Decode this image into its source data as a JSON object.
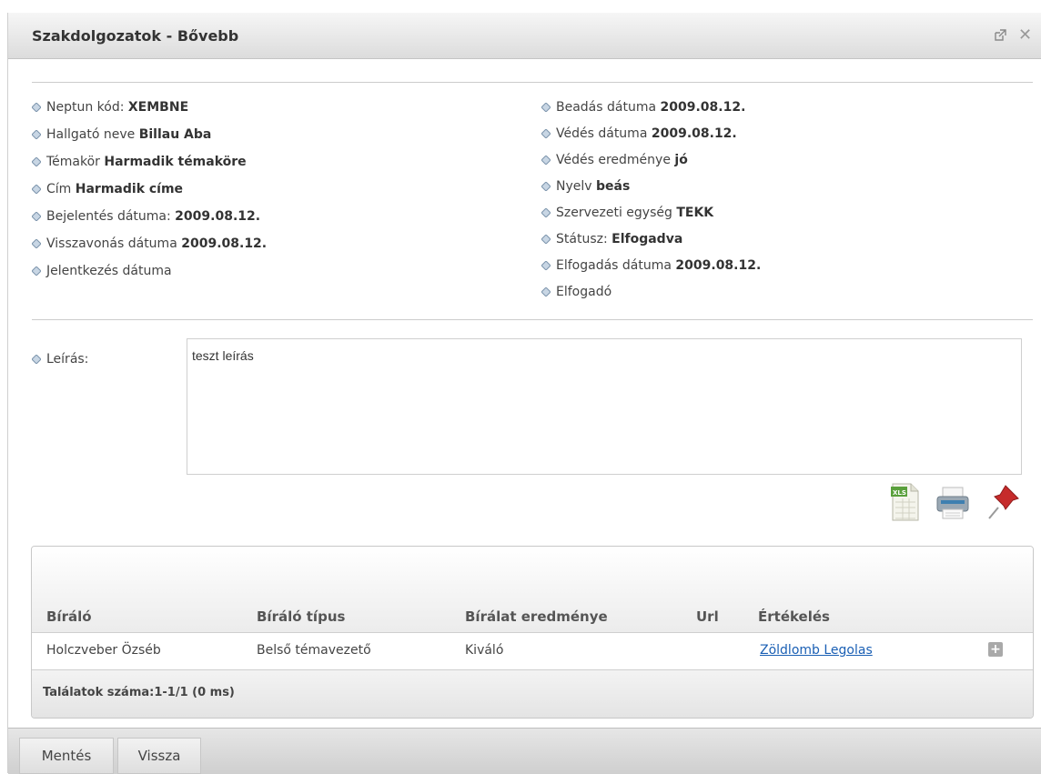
{
  "dialog": {
    "title": "Szakdolgozatok - Bővebb",
    "popout_icon": "external-window-icon",
    "close_icon": "close-icon"
  },
  "details": {
    "left": [
      {
        "label": "Neptun kód:",
        "value": "XEMBNE"
      },
      {
        "label": "Hallgató neve",
        "value": "Billau Aba"
      },
      {
        "label": "Témakör",
        "value": "Harmadik témaköre"
      },
      {
        "label": "Cím",
        "value": "Harmadik címe"
      },
      {
        "label": "Bejelentés dátuma:",
        "value": "2009.08.12."
      },
      {
        "label": "Visszavonás dátuma",
        "value": "2009.08.12."
      },
      {
        "label": "Jelentkezés dátuma",
        "value": ""
      }
    ],
    "right": [
      {
        "label": "Beadás dátuma",
        "value": "2009.08.12."
      },
      {
        "label": "Védés dátuma",
        "value": "2009.08.12."
      },
      {
        "label": "Védés eredménye",
        "value": "jó"
      },
      {
        "label": "Nyelv",
        "value": "beás"
      },
      {
        "label": "Szervezeti egység",
        "value": "TEKK"
      },
      {
        "label": "Státusz:",
        "value": "Elfogadva"
      },
      {
        "label": "Elfogadás dátuma",
        "value": "2009.08.12."
      },
      {
        "label": "Elfogadó",
        "value": ""
      }
    ]
  },
  "description": {
    "label": "Leírás:",
    "value": "teszt leírás"
  },
  "toolbar": {
    "icons": [
      "xls-export-icon",
      "printer-icon",
      "pushpin-icon"
    ]
  },
  "table": {
    "columns": [
      "Bíráló",
      "Bíráló típus",
      "Bírálat eredménye",
      "Url",
      "Értékelés"
    ],
    "rows": [
      {
        "biralo": "Holczveber Özséb",
        "tipus": "Belső témavezető",
        "eredmeny": "Kiváló",
        "url": "",
        "ertekeles": "Zöldlomb Legolas",
        "action_icon": "plus-icon"
      }
    ],
    "count_text": "Találatok száma:1-1/1 (0 ms)"
  },
  "buttons": {
    "save": "Mentés",
    "back": "Vissza"
  },
  "colors": {
    "link": "#1a5fb4",
    "bullet": "#8aa2b8"
  }
}
